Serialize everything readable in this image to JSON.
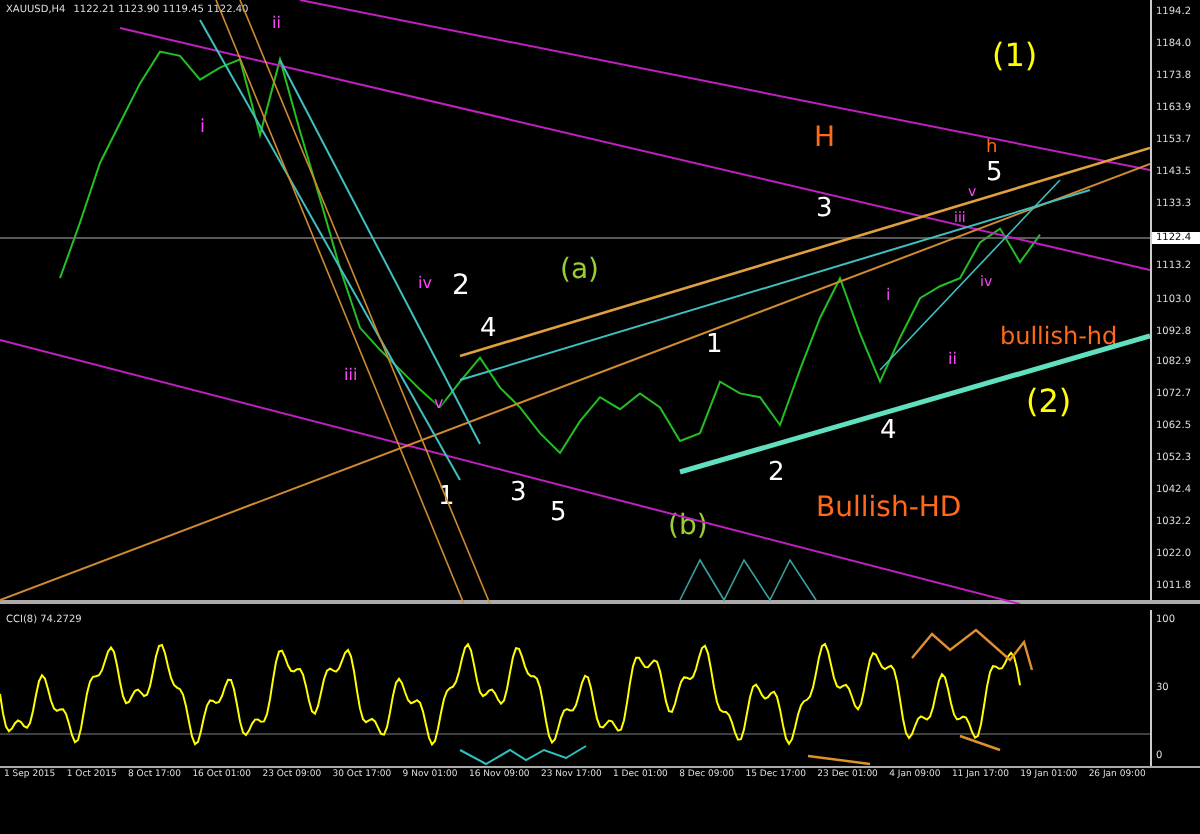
{
  "header": {
    "ohlc": "1122.21 1123.90 1119.45 1122.40"
  },
  "current_price": "1122.4",
  "chart_data": {
    "type": "line",
    "ylim": [
      1007.4,
      1198.0
    ],
    "yticks": [
      {
        "value": 1194.2,
        "label": "1194.2"
      },
      {
        "value": 1184.0,
        "label": "1184.0"
      },
      {
        "value": 1173.8,
        "label": "1173.8"
      },
      {
        "value": 1163.9,
        "label": "1163.9"
      },
      {
        "value": 1153.7,
        "label": "1153.7"
      },
      {
        "value": 1143.5,
        "label": "1143.5"
      },
      {
        "value": 1133.3,
        "label": "1133.3"
      },
      {
        "value": 1113.2,
        "label": "1113.2"
      },
      {
        "value": 1103.0,
        "label": "1103.0"
      },
      {
        "value": 1092.8,
        "label": "1092.8"
      },
      {
        "value": 1082.9,
        "label": "1082.9"
      },
      {
        "value": 1072.7,
        "label": "1072.7"
      },
      {
        "value": 1062.5,
        "label": "1062.5"
      },
      {
        "value": 1052.3,
        "label": "1052.3"
      },
      {
        "value": 1042.4,
        "label": "1042.4"
      },
      {
        "value": 1032.2,
        "label": "1032.2"
      },
      {
        "value": 1022.0,
        "label": "1022.0"
      },
      {
        "value": 1011.8,
        "label": "1011.8"
      }
    ],
    "series": [
      {
        "name": "XAUUSD,H4",
        "color": "#22c022",
        "values": [
          1109.6,
          1127.3,
          1146.2,
          1158.9,
          1171.5,
          1181.6,
          1180.3,
          1172.7,
          1176.5,
          1179.1,
          1155.1,
          1179.1,
          1156.3,
          1134.9,
          1112.8,
          1093.9,
          1086.9,
          1080.6,
          1074.3,
          1068.6,
          1076.8,
          1084.4,
          1074.9,
          1068.6,
          1060.4,
          1054.1,
          1064.2,
          1071.8,
          1068.0,
          1073.0,
          1068.6,
          1057.9,
          1060.4,
          1076.8,
          1073.0,
          1071.8,
          1063.0,
          1080.6,
          1097.0,
          1109.6,
          1092.0,
          1076.8,
          1090.7,
          1103.3,
          1107.1,
          1109.6,
          1121.0,
          1125.4,
          1114.7,
          1123.5
        ]
      }
    ]
  },
  "annotations": [
    {
      "text": "(1)",
      "color": "#ffff00"
    },
    {
      "text": "ii",
      "color": "#ff44ff"
    },
    {
      "text": "i",
      "color": "#ff44ff"
    },
    {
      "text": "H",
      "color": "#ff6a1a"
    },
    {
      "text": "h",
      "color": "#ff6a1a"
    },
    {
      "text": "5",
      "color": "#ffffff"
    },
    {
      "text": "v",
      "color": "#ff44ff"
    },
    {
      "text": "3",
      "color": "#ffffff"
    },
    {
      "text": "iii",
      "color": "#ff44ff"
    },
    {
      "text": "iv",
      "color": "#ff44ff"
    },
    {
      "text": "2",
      "color": "#ffffff"
    },
    {
      "text": "(a)",
      "color": "#9acd32"
    },
    {
      "text": "4",
      "color": "#ffffff"
    },
    {
      "text": "1",
      "color": "#ffffff"
    },
    {
      "text": "i",
      "color": "#ff44ff"
    },
    {
      "text": "iv",
      "color": "#ff44ff"
    },
    {
      "text": "bullish-hd",
      "color": "#ff6a1a"
    },
    {
      "text": "iii",
      "color": "#ff44ff"
    },
    {
      "text": "v",
      "color": "#ff44ff"
    },
    {
      "text": "ii",
      "color": "#ff44ff"
    },
    {
      "text": "(2)",
      "color": "#ffff00"
    },
    {
      "text": "4",
      "color": "#ffffff"
    },
    {
      "text": "1",
      "color": "#ffffff"
    },
    {
      "text": "3",
      "color": "#ffffff"
    },
    {
      "text": "2",
      "color": "#ffffff"
    },
    {
      "text": "5",
      "color": "#ffffff"
    },
    {
      "text": "(b)",
      "color": "#9acd32"
    },
    {
      "text": "Bullish-HD",
      "color": "#ff6a1a"
    }
  ],
  "indicator": {
    "label": "CCI(8) 74.2729",
    "scale": [
      "100",
      "30",
      "0"
    ]
  },
  "time_axis": [
    "1 Sep 2015",
    "1 Oct 2015",
    "8 Oct 17:00",
    "16 Oct 01:00",
    "23 Oct 09:00",
    "30 Oct 17:00",
    "9 Nov 01:00",
    "16 Nov 09:00",
    "23 Nov 17:00",
    "1 Dec 01:00",
    "8 Dec 09:00",
    "15 Dec 17:00",
    "23 Dec 01:00",
    "4 Jan 09:00",
    "11 Jan 17:00",
    "19 Jan 01:00",
    "26 Jan 09:00"
  ]
}
